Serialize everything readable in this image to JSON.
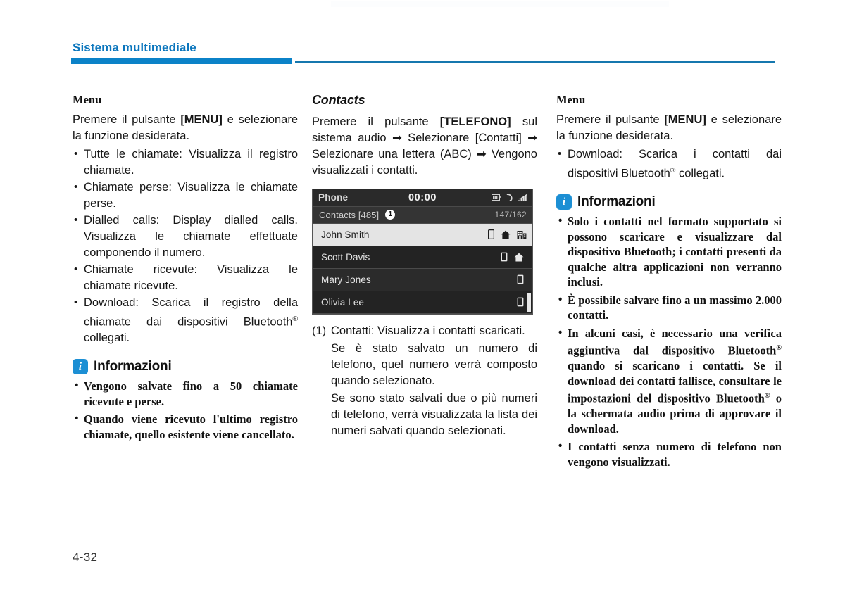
{
  "header": {
    "title": "Sistema multimediale",
    "accent_color": "#0b82c8",
    "rule_color": "#1577ae"
  },
  "footer": {
    "page_number": "4-32"
  },
  "columns": {
    "left": {
      "heading": "Menu",
      "intro": "Premere il pulsante [MENU] e selezionare la funzione desiderata.",
      "intro_bold": "[MENU]",
      "bullets": [
        "Tutte le chiamate: Visualizza il registro chiamate.",
        "Chiamate perse: Visualizza le chiamate perse.",
        "Dialled calls: Display dialled calls. Visualizza le chiamate effettuate componendo il numero.",
        "Chiamate ricevute: Visualizza le chiamate ricevute.",
        "Download: Scarica il registro della chiamate dai dispositivi Bluetooth® collegati."
      ],
      "info": {
        "badge": "i",
        "title": "Informazioni",
        "items": [
          "Vengono salvate fino a 50 chiamate ricevute e perse.",
          "Quando viene ricevuto l'ultimo registro chiamate, quello esistente viene cancellato."
        ]
      }
    },
    "middle": {
      "heading": "Contacts",
      "intro": "Premere il pulsante [TELEFONO] sul sistema audio ➜ Selezionare [Contatti] ➜ Selezionare una lettera (ABC) ➜ Vengono visualizzati i contatti.",
      "intro_bold": "[TELEFONO]",
      "screen": {
        "title": "Phone",
        "clock": "00:00",
        "status_icons": [
          "battery-icon",
          "bluetooth-phone-icon",
          "signal-strength-icon"
        ],
        "list_label": "Contacts [485]",
        "callout": "1",
        "counter": "147/162",
        "rows": [
          {
            "name": "John Smith",
            "selected": true,
            "icons": [
              "mobile-icon",
              "home-icon",
              "office-icon"
            ]
          },
          {
            "name": "Scott Davis",
            "selected": false,
            "icons": [
              "mobile-icon",
              "home-icon"
            ]
          },
          {
            "name": "Mary Jones",
            "selected": false,
            "icons": [
              "mobile-icon"
            ]
          },
          {
            "name": "Olivia Lee",
            "selected": false,
            "icons": [
              "mobile-icon"
            ]
          }
        ]
      },
      "note_marker": "(1)",
      "note_text": "Contatti: Visualizza i contatti scaricati.",
      "note_para_1": "Se è stato salvato un numero di telefono, quel numero verrà composto quando selezionato.",
      "note_para_2": "Se sono stato salvati due o più numeri di telefono, verrà visualizzata la lista dei numeri salvati quando selezionati."
    },
    "right": {
      "heading": "Menu",
      "intro": "Premere il pulsante [MENU] e selezionare la funzione desiderata.",
      "intro_bold": "[MENU]",
      "bullets": [
        "Download: Scarica i contatti dai dispositivi Bluetooth® collegati."
      ],
      "info": {
        "badge": "i",
        "title": "Informazioni",
        "items": [
          "Solo i contatti nel formato supportato si possono scaricare e visualizzare dal dispositivo Bluetooth; i contatti presenti da qualche altra applicazioni non verranno inclusi.",
          "È possibile salvare fino a un massimo 2.000 contatti.",
          "In alcuni casi, è necessario una verifica aggiuntiva dal dispositivo Bluetooth® quando si scaricano i contatti. Se il download dei contatti fallisce, consultare le impostazioni del dispositivo Bluetooth® o la schermata audio prima di approvare il download.",
          "I contatti senza numero di telefono non vengono visualizzati."
        ]
      }
    }
  }
}
